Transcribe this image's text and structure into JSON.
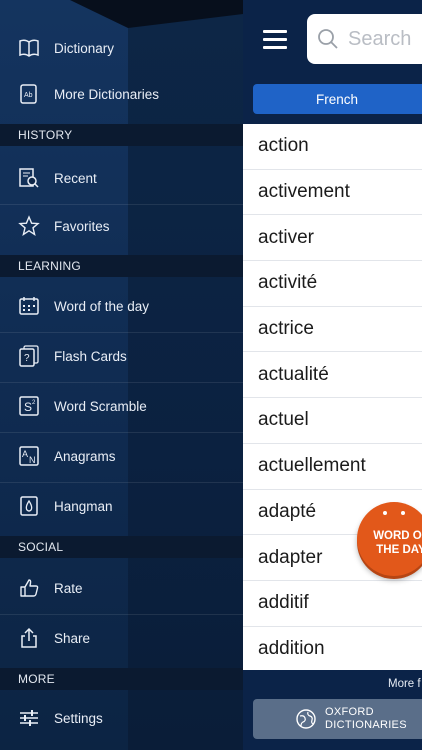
{
  "menu": {
    "items_top": [
      {
        "label": "Dictionary",
        "icon": "book-icon"
      },
      {
        "label": "More Dictionaries",
        "icon": "dictionary-book-icon"
      }
    ],
    "sections": {
      "history": "HISTORY",
      "learning": "LEARNING",
      "social": "SOCIAL",
      "more": "MORE"
    },
    "history_items": [
      {
        "label": "Recent",
        "icon": "recent-search-icon"
      },
      {
        "label": "Favorites",
        "icon": "star-icon"
      }
    ],
    "learning_items": [
      {
        "label": "Word of the day",
        "icon": "calendar-icon"
      },
      {
        "label": "Flash Cards",
        "icon": "flash-cards-icon"
      },
      {
        "label": "Word Scramble",
        "icon": "scramble-icon"
      },
      {
        "label": "Anagrams",
        "icon": "anagrams-icon"
      },
      {
        "label": "Hangman",
        "icon": "hangman-icon"
      }
    ],
    "social_items": [
      {
        "label": "Rate",
        "icon": "thumbs-up-icon"
      },
      {
        "label": "Share",
        "icon": "share-icon"
      }
    ],
    "more_items": [
      {
        "label": "Settings",
        "icon": "sliders-icon"
      }
    ]
  },
  "header": {
    "search_placeholder": "Search",
    "language_tab": "French"
  },
  "words": [
    "action",
    "activement",
    "activer",
    "activité",
    "actrice",
    "actualité",
    "actuel",
    "actuellement",
    "adapté",
    "adapter",
    "additif",
    "addition"
  ],
  "footer": {
    "more_link": "More f",
    "oxford_line1": "OXFORD",
    "oxford_line2": "DICTIONARIES"
  },
  "badge": {
    "line1": "WORD OF",
    "line2": "THE DAY"
  },
  "colors": {
    "menu_bg": "#0f2748",
    "top_bar": "#0b2348",
    "tab_blue": "#1f63c7",
    "badge_orange": "#e2581a"
  }
}
